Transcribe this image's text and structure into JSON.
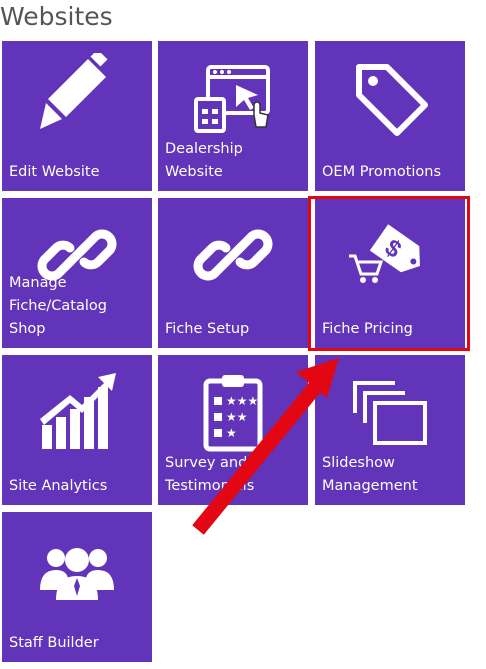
{
  "page": {
    "title": "Websites"
  },
  "tiles": [
    {
      "label": "Edit Website",
      "icon": "pencil-icon"
    },
    {
      "label": "Dealership Website",
      "icon": "browser-cursor-icon"
    },
    {
      "label": "OEM Promotions",
      "icon": "tag-icon"
    },
    {
      "label": "Manage\nFiche/Catalog Shop",
      "icon": "link-icon"
    },
    {
      "label": "Fiche Setup",
      "icon": "link-icon"
    },
    {
      "label": "Fiche Pricing",
      "icon": "price-tag-cart-icon"
    },
    {
      "label": "Site Analytics",
      "icon": "growth-chart-icon"
    },
    {
      "label": "Survey and\nTestimonials",
      "icon": "clipboard-rating-icon"
    },
    {
      "label": "Slideshow\nManagement",
      "icon": "slides-icon"
    },
    {
      "label": "Staff Builder",
      "icon": "team-icon"
    }
  ],
  "annotation": {
    "highlight_color": "#e30613",
    "highlighted_tile": "Fiche Pricing"
  },
  "colors": {
    "tile_bg": "#6234b9",
    "title": "#555555"
  }
}
